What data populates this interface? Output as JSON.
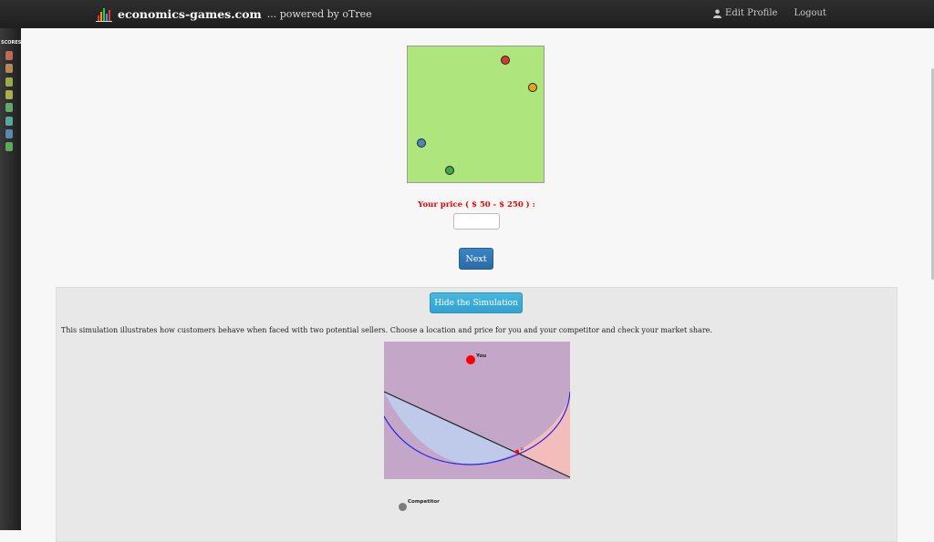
{
  "header": {
    "brand_name": "economics-games.com",
    "brand_tagline": "... powered by oTree",
    "edit_profile_label": "Edit Profile",
    "logout_label": "Logout"
  },
  "sidebar": {
    "label": "SCORES",
    "chips": [
      "#c0685a",
      "#b58a5a",
      "#9aaa4e",
      "#aab04e",
      "#5faa6a",
      "#55a89c",
      "#5a86b0",
      "#5aaa5a"
    ]
  },
  "market_field": {
    "dots": [
      {
        "name": "red",
        "color": "#d63a2a"
      },
      {
        "name": "orange",
        "color": "#e2a21c"
      },
      {
        "name": "blue",
        "color": "#4a87bb"
      },
      {
        "name": "green",
        "color": "#3fa64c"
      }
    ]
  },
  "form": {
    "price_label": "Your price ( $ 50 - $ 250 ) :",
    "price_value": "",
    "next_label": "Next"
  },
  "simulation": {
    "hide_label": "Hide the Simulation",
    "description": "This simulation illustrates how customers behave when faced with two potential sellers. Choose a location and price for you and your competitor and check your market share.",
    "you_label": "You",
    "competitor_label": "Competitor",
    "colors": {
      "purple_region": "#c3a6c8",
      "blue_region": "#bfc9e9",
      "pink_region": "#f2bdbb",
      "circle": "#2222ee",
      "divider": "#222222",
      "you_dot": "#ff0000",
      "competitor_dot": "#7c7c7c"
    }
  }
}
